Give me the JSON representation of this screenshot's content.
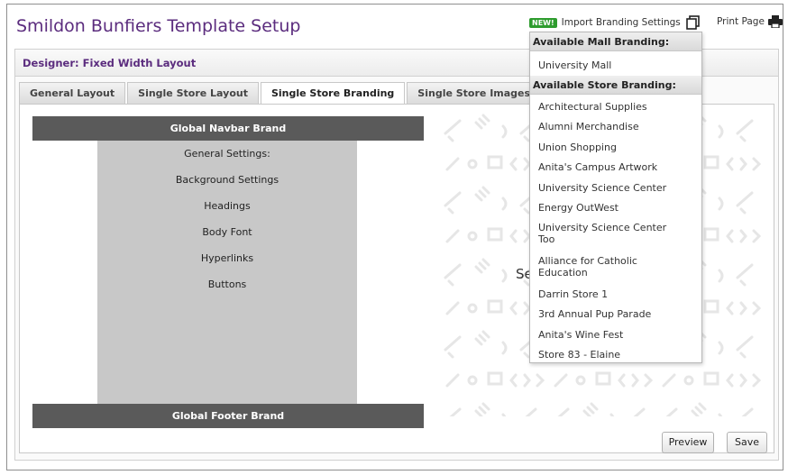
{
  "header": {
    "title": "Smildon Bunfiers Template Setup",
    "new_badge": "NEW!",
    "import_label": "Import Branding Settings",
    "print_label": "Print Page"
  },
  "designer": {
    "label": "Designer: Fixed Width Layout"
  },
  "tabs": [
    {
      "label": "General Layout",
      "active": false
    },
    {
      "label": "Single Store Layout",
      "active": false
    },
    {
      "label": "Single Store Branding",
      "active": true
    },
    {
      "label": "Single Store Images",
      "active": false
    }
  ],
  "preview": {
    "navbar": "Global Navbar Brand",
    "footer": "Global Footer Brand",
    "settings": [
      "General Settings:",
      "Background Settings",
      "Headings",
      "Body Font",
      "Hyperlinks",
      "Buttons"
    ]
  },
  "behind_text": "Se",
  "buttons": {
    "preview": "Preview",
    "save": "Save"
  },
  "dropdown": {
    "mall_header": "Available Mall Branding:",
    "mall_items": [
      "University Mall"
    ],
    "store_header": "Available Store Branding:",
    "store_items": [
      "Architectural Supplies",
      "Alumni Merchandise",
      "Union Shopping",
      "Anita's Campus Artwork",
      "University Science Center",
      "Energy OutWest",
      "University Science Center Too",
      "Alliance for Catholic Education",
      "Darrin Store 1",
      "3rd Annual Pup Parade",
      "Anita's Wine Fest",
      "Store 83 - Elaine"
    ]
  },
  "colors": {
    "title": "#5b2c7e",
    "brand_bar": "#5a5a5a",
    "settings_bg": "#c8c8c8",
    "new_badge": "#2e9c2e"
  }
}
